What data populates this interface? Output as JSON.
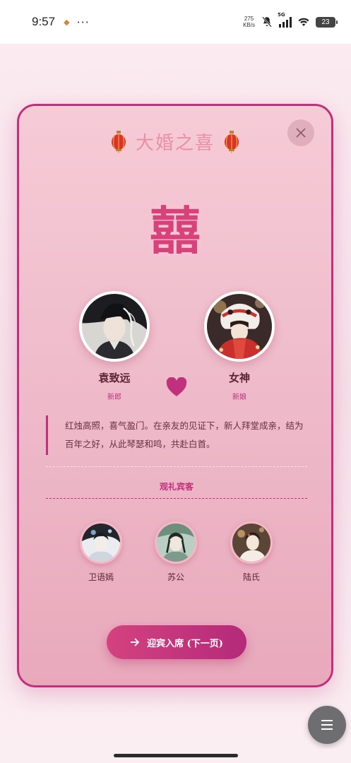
{
  "status_bar": {
    "time": "9:57",
    "dots": "···",
    "net_speed_value": "275",
    "net_speed_unit": "KB/s",
    "network_type": "5G",
    "battery": "23"
  },
  "modal": {
    "title": "大婚之喜",
    "xi_char": "囍",
    "groom": {
      "name": "袁致远",
      "role": "新郎"
    },
    "bride": {
      "name": "女神",
      "role": "新娘"
    },
    "blessing": "红烛高照，喜气盈门。在亲友的见证下，新人拜堂成亲，结为百年之好，从此琴瑟和鸣，共赴白首。",
    "guests_heading": "观礼宾客",
    "guests": [
      {
        "name": "卫语嫣"
      },
      {
        "name": "苏公"
      },
      {
        "name": "陆氏"
      }
    ],
    "next_button_label": "迎宾入席 (下一页)"
  },
  "colors": {
    "accent": "#c0307d",
    "card_bg_top": "#f6cbd6",
    "card_bg_bottom": "#e8a9bb",
    "title_pink": "#e890a8",
    "xi_red": "#d7427a"
  },
  "icons": [
    "lantern-icon",
    "close-icon",
    "heart-icon",
    "arrow-right-icon",
    "menu-icon",
    "bell-off-icon",
    "wifi-icon",
    "signal-icon",
    "battery-icon"
  ]
}
